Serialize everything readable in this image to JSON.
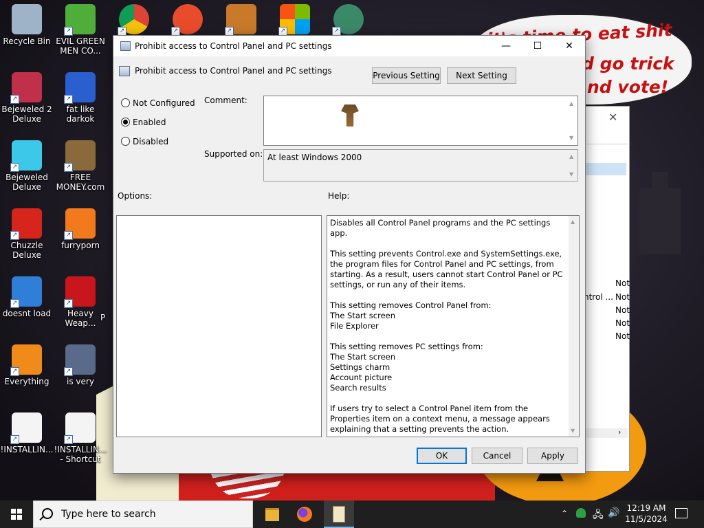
{
  "desktop": {
    "icons": [
      {
        "label": "Recycle Bin",
        "icon": "recycle-bin-icon",
        "color": "#9fb3c8"
      },
      {
        "label": "EVIL GREEN MEN CO...",
        "icon": "green-men-icon",
        "color": "#4fae3a"
      },
      {
        "label": "Bejeweled 2 Deluxe",
        "icon": "bejeweled2-icon",
        "color": "#c0304a"
      },
      {
        "label": "fat like darkok",
        "icon": "mpl-icon",
        "color": "#2a5fd0"
      },
      {
        "label": "Bejeweled Deluxe",
        "icon": "gem-icon",
        "color": "#3cc8e8"
      },
      {
        "label": "FREE MONEY.com",
        "icon": "money-bag-icon",
        "color": "#8a6a3a"
      },
      {
        "label": "Chuzzle Deluxe",
        "icon": "chuzzle-icon",
        "color": "#d8251c"
      },
      {
        "label": "furryporn",
        "icon": "firefox-icon",
        "color": "#f27a1c"
      },
      {
        "label": "doesnt load",
        "icon": "thunderbird-icon",
        "color": "#2f7fd8"
      },
      {
        "label": "Heavy Weap...",
        "icon": "radiation-icon",
        "color": "#c8161c"
      },
      {
        "label": "Everything",
        "icon": "everything-search-icon",
        "color": "#f08a1a"
      },
      {
        "label": "is very",
        "icon": "mpl-shield-icon",
        "color": "#5a6a8a"
      },
      {
        "label": "!INSTALLIN...",
        "icon": "document-icon",
        "color": "#f4f4f4"
      },
      {
        "label": "!INSTALLIN... - Shortcut",
        "icon": "document-shortcut-icon",
        "color": "#f4f4f4"
      }
    ],
    "partial_label": "P",
    "bubble_lines": [
      "it's time to eat shit",
      "d go trick",
      "nd vote!"
    ]
  },
  "backwindow": {
    "rows": [
      "Not",
      "ntrol ...",
      "Not",
      "Not",
      "Not",
      "Not"
    ]
  },
  "dialog": {
    "title": "Prohibit access to Control Panel and PC settings",
    "header_title": "Prohibit access to Control Panel and PC settings",
    "previous_label": "Previous Setting",
    "next_label": "Next Setting",
    "radios": [
      {
        "label": "Not Configured",
        "checked": false
      },
      {
        "label": "Enabled",
        "checked": true
      },
      {
        "label": "Disabled",
        "checked": false
      }
    ],
    "comment_label": "Comment:",
    "supported_label": "Supported on:",
    "supported_value": "At least Windows 2000",
    "options_label": "Options:",
    "help_label": "Help:",
    "help_text": "Disables all Control Panel programs and the PC settings app.\n\nThis setting prevents Control.exe and SystemSettings.exe, the program files for Control Panel and PC settings, from starting. As a result, users cannot start Control Panel or PC settings, or run any of their items.\n\nThis setting removes Control Panel from:\nThe Start screen\nFile Explorer\n\nThis setting removes PC settings from:\nThe Start screen\nSettings charm\nAccount picture\nSearch results\n\nIf users try to select a Control Panel item from the Properties item on a context menu, a message appears explaining that a setting prevents the action.",
    "ok_label": "OK",
    "cancel_label": "Cancel",
    "apply_label": "Apply",
    "minimize_glyph": "—",
    "maximize_glyph": "☐",
    "close_glyph": "✕"
  },
  "taskbar": {
    "search_placeholder": "Type here to search",
    "time": "12:19 AM",
    "date": "11/5/2024",
    "accent": "#76b9ed"
  }
}
